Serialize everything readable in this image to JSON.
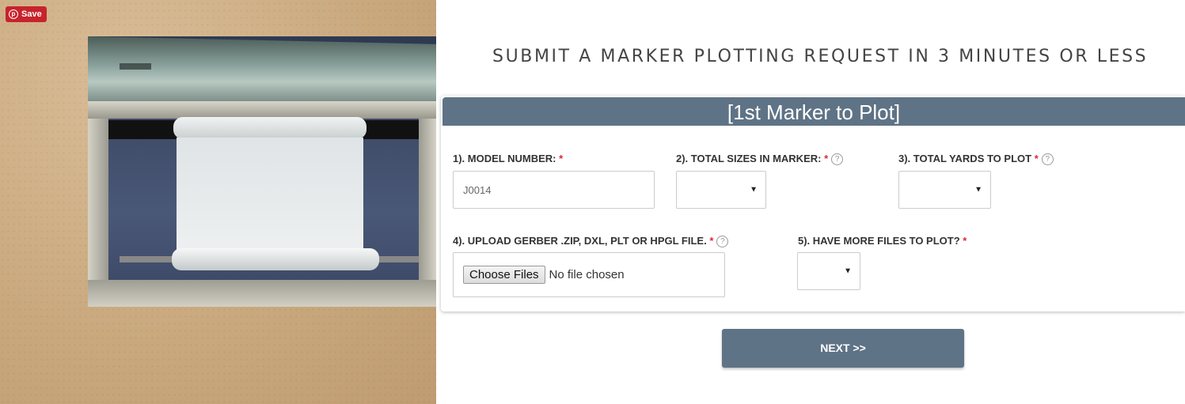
{
  "pin": {
    "save_label": "Save",
    "icon": "pinterest-icon",
    "color": "#c8232c"
  },
  "heading": "SUBMIT A MARKER PLOTTING REQUEST IN 3 MINUTES OR LESS",
  "form": {
    "title": "[1st Marker to Plot]",
    "header_color": "#5f7386",
    "required_mark": "*",
    "help_glyph": "?",
    "fields": [
      {
        "label": "1). MODEL NUMBER:",
        "value": "J0014"
      },
      {
        "label": "2). TOTAL SIZES IN MARKER:",
        "value": ""
      },
      {
        "label": "3). TOTAL YARDS TO PLOT",
        "value": ""
      },
      {
        "label": "4). UPLOAD GERBER .ZIP, DXL, PLT OR HPGL FILE.",
        "button": "Choose Files",
        "status": "No file chosen"
      },
      {
        "label": "5). HAVE MORE FILES TO PLOT?",
        "value": ""
      }
    ]
  },
  "next_button": "NEXT >>"
}
